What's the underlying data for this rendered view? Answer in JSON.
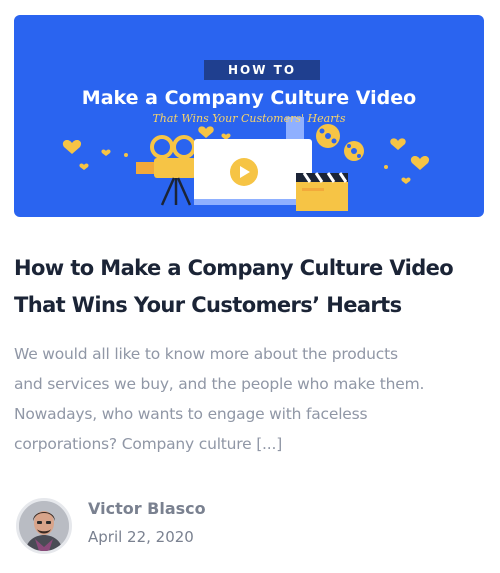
{
  "post": {
    "image": {
      "tag": "HOW TO",
      "title": "Make a Company Culture Video",
      "subtitle": "That Wins Your Customers' Hearts",
      "colors": {
        "background": "#2a64f0",
        "tag_bg": "#1f3f8f",
        "accent": "#f6c445"
      },
      "icons": [
        "heart-icon",
        "video-camera-icon",
        "video-player-icon",
        "clapperboard-icon",
        "film-reel-icon"
      ]
    },
    "title_line1": "How to Make a Company Culture Video",
    "title_line2": "That Wins Your Customers’ Hearts",
    "excerpt_lines": [
      "We would all like to know more about the products",
      "and services we buy, and the people who make them.",
      "Nowadays, who wants to engage with faceless",
      "corporations? Company culture [...]"
    ],
    "author": {
      "name": "Victor Blasco",
      "date": "April 22, 2020"
    }
  }
}
